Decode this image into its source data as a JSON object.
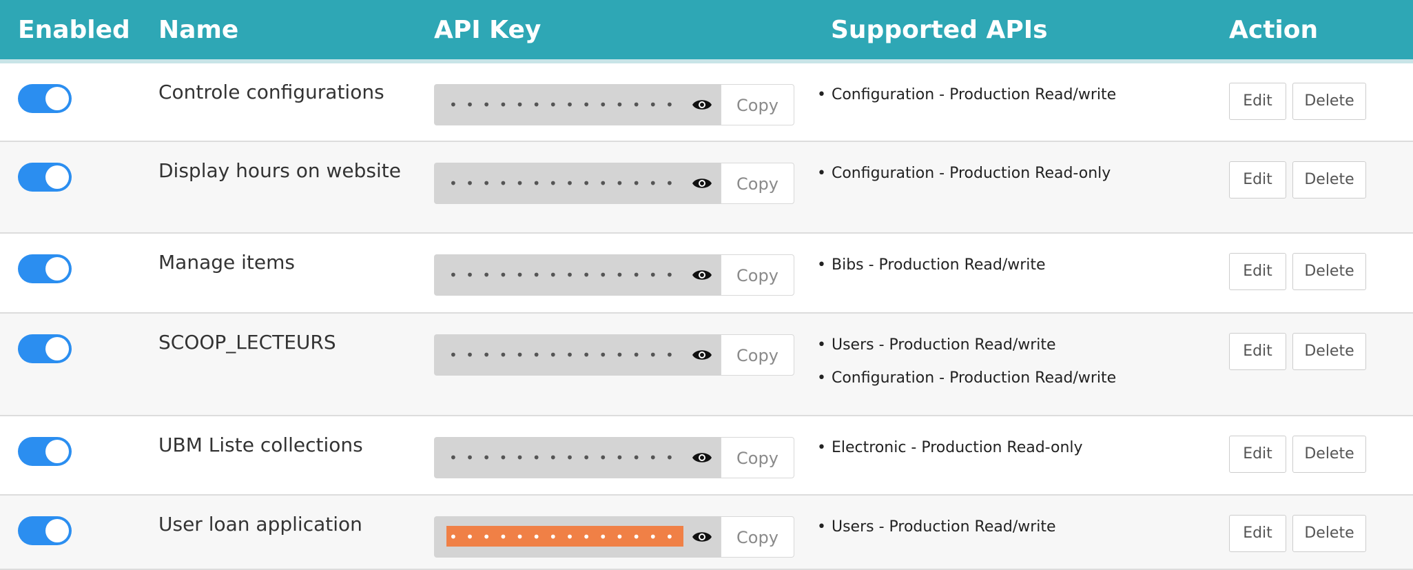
{
  "header": {
    "enabled": "Enabled",
    "name": "Name",
    "api_key": "API Key",
    "supported_apis": "Supported APIs",
    "action": "Action"
  },
  "colors": {
    "header_bg": "#2ea7b5",
    "toggle_on": "#2b8ef0",
    "key_field_bg": "#d4d4d4",
    "key_selected": "#f08046"
  },
  "key_mask": "• • • • • • • • • • • • • • • • • • • • •",
  "copy_label": "Copy",
  "edit_label": "Edit",
  "delete_label": "Delete",
  "rows": [
    {
      "enabled": true,
      "name": "Controle configurations",
      "key_selected": false,
      "apis": [
        "Configuration - Production Read/write"
      ]
    },
    {
      "enabled": true,
      "name": "Display hours on website",
      "key_selected": false,
      "apis": [
        "Configuration - Production Read-only"
      ]
    },
    {
      "enabled": true,
      "name": "Manage items",
      "key_selected": false,
      "apis": [
        "Bibs - Production Read/write"
      ]
    },
    {
      "enabled": true,
      "name": "SCOOP_LECTEURS",
      "key_selected": false,
      "apis": [
        "Users - Production Read/write",
        "Configuration - Production Read/write"
      ]
    },
    {
      "enabled": true,
      "name": "UBM Liste collections",
      "key_selected": false,
      "apis": [
        "Electronic - Production Read-only"
      ]
    },
    {
      "enabled": true,
      "name": "User loan application",
      "key_selected": true,
      "apis": [
        "Users - Production Read/write"
      ]
    }
  ]
}
